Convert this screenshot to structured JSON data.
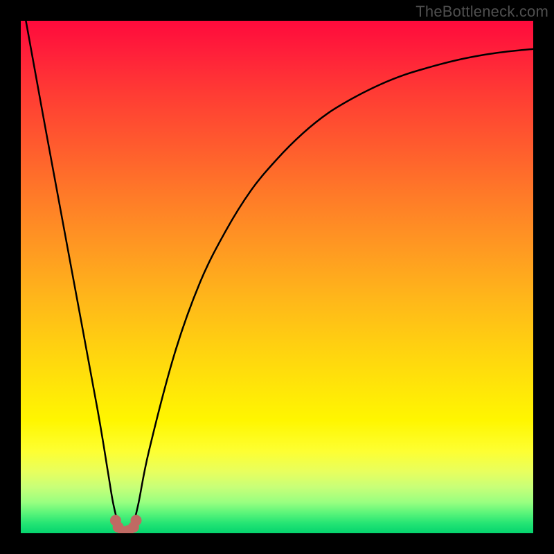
{
  "watermark": "TheBottleneck.com",
  "chart_data": {
    "type": "line",
    "title": "",
    "xlabel": "",
    "ylabel": "",
    "xlim": [
      0,
      100
    ],
    "ylim": [
      0,
      100
    ],
    "grid": false,
    "legend": false,
    "background_gradient": {
      "top": "#ff0a3c",
      "mid": "#ffe708",
      "bottom": "#04d46e"
    },
    "series": [
      {
        "name": "bottleneck-curve",
        "stroke": "#000000",
        "x": [
          1,
          5,
          10,
          15,
          17,
          18,
          19,
          20,
          21,
          22,
          23,
          25,
          30,
          35,
          40,
          45,
          50,
          55,
          60,
          65,
          70,
          75,
          80,
          85,
          90,
          95,
          100
        ],
        "y": [
          100,
          78,
          51,
          24,
          12,
          6,
          2,
          0,
          0,
          2,
          6,
          16,
          35,
          49,
          59,
          67,
          73,
          78,
          82,
          85,
          87.5,
          89.5,
          91,
          92.3,
          93.3,
          94,
          94.5
        ]
      },
      {
        "name": "marker-cluster",
        "type": "scatter",
        "color": "#c06a63",
        "x": [
          18.5,
          19,
          20,
          20.5,
          21,
          22,
          22.5
        ],
        "y": [
          2.5,
          1.2,
          0.3,
          0.3,
          0.5,
          1.2,
          2.5
        ]
      }
    ],
    "minimum_x": 20
  }
}
